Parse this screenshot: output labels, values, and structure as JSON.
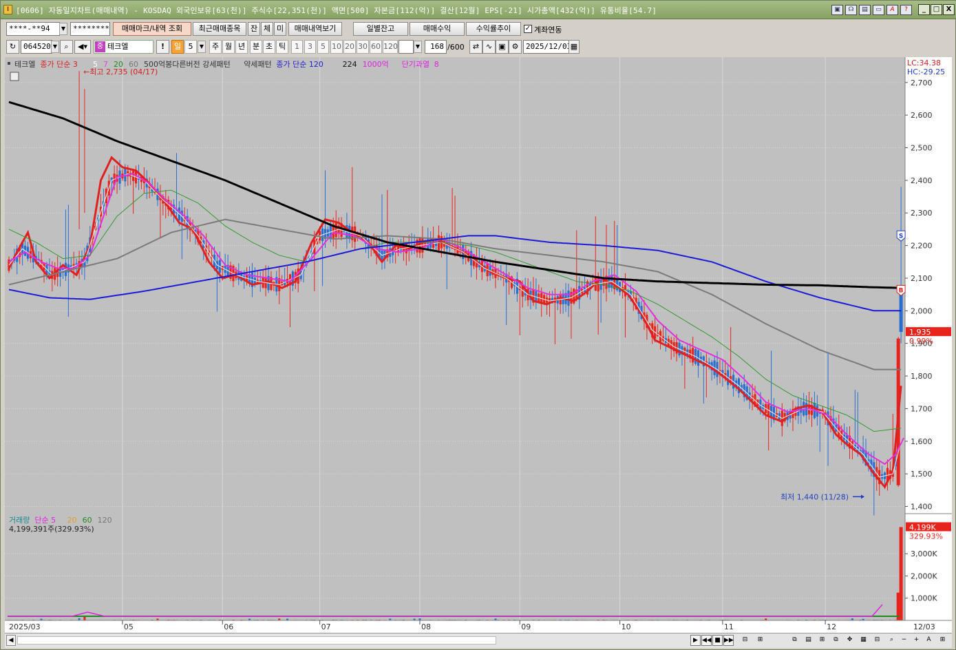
{
  "titlebar": {
    "app_icon": "I",
    "title": "[0606] 자동일지차트(매매내역) - KOSDAQ 외국인보유[63(천)] 주식수[22,351(천)] 액면[500] 자본금[112(억)] 결산[12월] EPS[-21] 시가총액[432(억)] 유통비율[54.7]",
    "icons": [
      "window-icon",
      "link-icon",
      "chart-icon",
      "monitor-icon",
      "a-icon",
      "help-icon"
    ],
    "icon_glyphs": [
      "▣",
      "☊",
      "▤",
      "▭",
      "A",
      "?"
    ],
    "controls": {
      "minimize": "_",
      "maximize": "□",
      "close": "X"
    }
  },
  "toolbar1": {
    "account_value": "****-**94",
    "password_value": "*********",
    "buttons": [
      "매매마크/내역 조회",
      "최근매매종목",
      "잔",
      "체",
      "미",
      "매매내역보기"
    ],
    "right_buttons": [
      "일별잔고",
      "매매수익",
      "수익률추이"
    ],
    "link_checkbox_label": "계좌연동",
    "link_checked": true
  },
  "toolbar2": {
    "stock_code": "064520",
    "stock_name": "테크엘",
    "stock_badge": "중",
    "period_buttons": [
      "일",
      "5",
      "주",
      "월",
      "년",
      "분",
      "초",
      "틱"
    ],
    "interval_buttons": [
      "1",
      "3",
      "5",
      "10",
      "20",
      "30",
      "60",
      "120"
    ],
    "count_value": "168",
    "count_total": "/600",
    "date_value": "2025/12/03",
    "bang": "!"
  },
  "price_legend": [
    {
      "text": "테크엘",
      "color": "#333333"
    },
    {
      "text": "종가 단순 3",
      "color": "#d62020"
    },
    {
      "text": "5",
      "color": "#ffffff"
    },
    {
      "text": "7",
      "color": "#e040e0"
    },
    {
      "text": "20",
      "color": "#208a20"
    },
    {
      "text": "60",
      "color": "#777777"
    },
    {
      "text": "500억봉다른버전 강세패턴",
      "color": "#333333"
    },
    {
      "text": "약세패턴",
      "color": "#333333"
    },
    {
      "text": "종가 단순 120",
      "color": "#2020d0"
    },
    {
      "text": "224",
      "color": "#111111"
    },
    {
      "text": "1000억",
      "color": "#e020e0"
    },
    {
      "text": "단기과열",
      "color": "#e020e0"
    },
    {
      "text": "8",
      "color": "#e020e0"
    }
  ],
  "volume_legend": [
    {
      "text": "거래량",
      "color": "#1a8a8a"
    },
    {
      "text": "단순 5",
      "color": "#e020e0"
    },
    {
      "text": "20",
      "color": "#e0a020"
    },
    {
      "text": "60",
      "color": "#208a20"
    },
    {
      "text": "120",
      "color": "#777777"
    }
  ],
  "volume_value_text": "4,199,391주(329.93%)",
  "lc_text": "LC:34.38",
  "hc_text": "HC:-29.25",
  "max_annotation": "←최고 2,735 (04/17)",
  "min_annotation": "최저 1,440 (11/28)",
  "current_price_tag": "1,935",
  "current_pct_tag": "0.99%",
  "volume_tag": "4,199K",
  "volume_pct_tag": "329.93%",
  "signal_sell": "S",
  "signal_buy": "B",
  "price_axis_ticks": [
    "2,700",
    "2,600",
    "2,500",
    "2,400",
    "2,300",
    "2,200",
    "2,100",
    "2,000",
    "1,900",
    "1,800",
    "1,700",
    "1,600",
    "1,500",
    "1,400"
  ],
  "volume_axis_ticks": [
    "3,000K",
    "2,000K",
    "1,000K"
  ],
  "date_axis_labels": [
    "2025/03",
    "05",
    "06",
    "07",
    "08",
    "09",
    "10",
    "11",
    "12",
    "12/03"
  ],
  "colors": {
    "chart_bg": "#c0c0c0",
    "up_candle": "#e8231c",
    "down_candle": "#2a6fd0",
    "ma3": "#e02020",
    "ma5": "#f4f4f4",
    "ma7": "#e030e0",
    "ma20": "#2f9a2f",
    "ma60": "#7a7a7a",
    "ma120": "#1a1ad8",
    "ma224": "#000000"
  },
  "chart_data": {
    "type": "candlestick",
    "y_range": [
      1380,
      2765
    ],
    "volume_range": [
      0,
      4400
    ],
    "volume_unit": "K",
    "max_point": {
      "price": 2735,
      "date": "04/17"
    },
    "min_point": {
      "price": 1440,
      "date": "11/28"
    },
    "last_close": 1935,
    "last_volume_k": 4199,
    "series": [
      {
        "name": "종가 단순 3",
        "points": [
          [
            0,
            2130
          ],
          [
            3,
            2180
          ],
          [
            7,
            2240
          ],
          [
            10,
            2150
          ],
          [
            15,
            2100
          ],
          [
            20,
            2140
          ],
          [
            25,
            2110
          ],
          [
            30,
            2200
          ],
          [
            34,
            2400
          ],
          [
            38,
            2470
          ],
          [
            42,
            2440
          ],
          [
            47,
            2430
          ],
          [
            52,
            2390
          ],
          [
            58,
            2330
          ],
          [
            63,
            2270
          ],
          [
            68,
            2250
          ],
          [
            74,
            2150
          ],
          [
            79,
            2100
          ],
          [
            84,
            2110
          ],
          [
            90,
            2080
          ],
          [
            96,
            2090
          ],
          [
            101,
            2070
          ],
          [
            106,
            2090
          ],
          [
            112,
            2210
          ],
          [
            117,
            2280
          ],
          [
            122,
            2270
          ],
          [
            127,
            2240
          ],
          [
            133,
            2210
          ],
          [
            138,
            2150
          ],
          [
            143,
            2200
          ],
          [
            148,
            2190
          ],
          [
            153,
            2210
          ],
          [
            158,
            2220
          ],
          [
            163,
            2200
          ],
          [
            168,
            2180
          ],
          [
            173,
            2150
          ],
          [
            178,
            2120
          ],
          [
            184,
            2100
          ],
          [
            189,
            2090
          ],
          [
            194,
            2030
          ],
          [
            199,
            2020
          ],
          [
            204,
            2040
          ],
          [
            209,
            2030
          ],
          [
            214,
            2060
          ],
          [
            219,
            2100
          ],
          [
            224,
            2080
          ],
          [
            229,
            2050
          ],
          [
            234,
            1990
          ],
          [
            239,
            1910
          ],
          [
            244,
            1890
          ],
          [
            249,
            1870
          ],
          [
            254,
            1850
          ],
          [
            259,
            1830
          ],
          [
            264,
            1800
          ],
          [
            270,
            1760
          ],
          [
            275,
            1720
          ],
          [
            280,
            1680
          ],
          [
            286,
            1660
          ],
          [
            291,
            1700
          ],
          [
            296,
            1710
          ],
          [
            301,
            1690
          ],
          [
            306,
            1620
          ],
          [
            310,
            1590
          ],
          [
            315,
            1560
          ],
          [
            320,
            1500
          ],
          [
            324,
            1460
          ],
          [
            327,
            1510
          ],
          [
            330,
            1770
          ]
        ]
      },
      {
        "name": "5",
        "points": [
          [
            0,
            2140
          ],
          [
            5,
            2190
          ],
          [
            10,
            2160
          ],
          [
            16,
            2110
          ],
          [
            22,
            2130
          ],
          [
            28,
            2150
          ],
          [
            33,
            2280
          ],
          [
            38,
            2400
          ],
          [
            44,
            2420
          ],
          [
            50,
            2400
          ],
          [
            57,
            2340
          ],
          [
            64,
            2290
          ],
          [
            70,
            2230
          ],
          [
            77,
            2140
          ],
          [
            84,
            2110
          ],
          [
            92,
            2090
          ],
          [
            100,
            2080
          ],
          [
            108,
            2110
          ],
          [
            115,
            2230
          ],
          [
            122,
            2250
          ],
          [
            130,
            2230
          ],
          [
            138,
            2170
          ],
          [
            145,
            2190
          ],
          [
            152,
            2200
          ],
          [
            160,
            2210
          ],
          [
            168,
            2180
          ],
          [
            176,
            2130
          ],
          [
            184,
            2100
          ],
          [
            192,
            2050
          ],
          [
            200,
            2030
          ],
          [
            208,
            2040
          ],
          [
            216,
            2080
          ],
          [
            223,
            2090
          ],
          [
            230,
            2050
          ],
          [
            238,
            1940
          ],
          [
            246,
            1890
          ],
          [
            254,
            1860
          ],
          [
            262,
            1820
          ],
          [
            270,
            1770
          ],
          [
            278,
            1710
          ],
          [
            286,
            1670
          ],
          [
            294,
            1700
          ],
          [
            301,
            1690
          ],
          [
            308,
            1620
          ],
          [
            316,
            1560
          ],
          [
            322,
            1490
          ],
          [
            327,
            1500
          ],
          [
            330,
            1600
          ]
        ]
      },
      {
        "name": "7",
        "points": [
          [
            0,
            2150
          ],
          [
            6,
            2180
          ],
          [
            12,
            2150
          ],
          [
            18,
            2130
          ],
          [
            24,
            2130
          ],
          [
            30,
            2170
          ],
          [
            35,
            2290
          ],
          [
            40,
            2410
          ],
          [
            46,
            2420
          ],
          [
            52,
            2390
          ],
          [
            58,
            2340
          ],
          [
            65,
            2290
          ],
          [
            72,
            2230
          ],
          [
            80,
            2140
          ],
          [
            88,
            2110
          ],
          [
            96,
            2100
          ],
          [
            104,
            2090
          ],
          [
            112,
            2160
          ],
          [
            120,
            2240
          ],
          [
            128,
            2230
          ],
          [
            136,
            2190
          ],
          [
            144,
            2180
          ],
          [
            152,
            2190
          ],
          [
            160,
            2220
          ],
          [
            168,
            2190
          ],
          [
            176,
            2150
          ],
          [
            184,
            2110
          ],
          [
            192,
            2070
          ],
          [
            200,
            2050
          ],
          [
            208,
            2050
          ],
          [
            216,
            2090
          ],
          [
            224,
            2110
          ],
          [
            232,
            2060
          ],
          [
            240,
            1970
          ],
          [
            248,
            1910
          ],
          [
            256,
            1880
          ],
          [
            264,
            1850
          ],
          [
            272,
            1790
          ],
          [
            280,
            1720
          ],
          [
            288,
            1690
          ],
          [
            296,
            1700
          ],
          [
            303,
            1680
          ],
          [
            310,
            1620
          ],
          [
            318,
            1560
          ],
          [
            324,
            1530
          ],
          [
            328,
            1560
          ],
          [
            331,
            1610
          ]
        ]
      },
      {
        "name": "20",
        "points": [
          [
            0,
            2250
          ],
          [
            10,
            2210
          ],
          [
            20,
            2160
          ],
          [
            30,
            2170
          ],
          [
            40,
            2290
          ],
          [
            50,
            2360
          ],
          [
            60,
            2370
          ],
          [
            70,
            2330
          ],
          [
            80,
            2260
          ],
          [
            90,
            2210
          ],
          [
            100,
            2170
          ],
          [
            110,
            2150
          ],
          [
            120,
            2170
          ],
          [
            130,
            2190
          ],
          [
            140,
            2210
          ],
          [
            150,
            2210
          ],
          [
            160,
            2210
          ],
          [
            170,
            2200
          ],
          [
            180,
            2180
          ],
          [
            190,
            2150
          ],
          [
            200,
            2120
          ],
          [
            210,
            2090
          ],
          [
            220,
            2080
          ],
          [
            230,
            2060
          ],
          [
            240,
            2020
          ],
          [
            250,
            1970
          ],
          [
            260,
            1920
          ],
          [
            270,
            1860
          ],
          [
            280,
            1790
          ],
          [
            290,
            1740
          ],
          [
            300,
            1710
          ],
          [
            310,
            1680
          ],
          [
            320,
            1630
          ],
          [
            330,
            1640
          ]
        ]
      },
      {
        "name": "60",
        "points": [
          [
            0,
            2080
          ],
          [
            20,
            2120
          ],
          [
            40,
            2160
          ],
          [
            60,
            2240
          ],
          [
            80,
            2280
          ],
          [
            100,
            2250
          ],
          [
            120,
            2220
          ],
          [
            140,
            2230
          ],
          [
            160,
            2220
          ],
          [
            180,
            2190
          ],
          [
            200,
            2170
          ],
          [
            220,
            2150
          ],
          [
            240,
            2120
          ],
          [
            260,
            2050
          ],
          [
            280,
            1960
          ],
          [
            300,
            1880
          ],
          [
            320,
            1820
          ],
          [
            330,
            1820
          ]
        ]
      },
      {
        "name": "종가 단순 120",
        "points": [
          [
            0,
            2065
          ],
          [
            15,
            2040
          ],
          [
            30,
            2035
          ],
          [
            50,
            2060
          ],
          [
            70,
            2090
          ],
          [
            90,
            2120
          ],
          [
            110,
            2150
          ],
          [
            130,
            2190
          ],
          [
            150,
            2210
          ],
          [
            170,
            2230
          ],
          [
            180,
            2230
          ],
          [
            200,
            2210
          ],
          [
            220,
            2200
          ],
          [
            240,
            2185
          ],
          [
            260,
            2150
          ],
          [
            280,
            2090
          ],
          [
            300,
            2040
          ],
          [
            320,
            2000
          ],
          [
            330,
            2000
          ]
        ]
      },
      {
        "name": "224",
        "points": [
          [
            0,
            2640
          ],
          [
            20,
            2590
          ],
          [
            40,
            2520
          ],
          [
            60,
            2460
          ],
          [
            80,
            2400
          ],
          [
            100,
            2330
          ],
          [
            120,
            2260
          ],
          [
            140,
            2210
          ],
          [
            160,
            2180
          ],
          [
            180,
            2150
          ],
          [
            200,
            2125
          ],
          [
            220,
            2100
          ],
          [
            240,
            2090
          ],
          [
            260,
            2085
          ],
          [
            280,
            2080
          ],
          [
            300,
            2078
          ],
          [
            320,
            2072
          ],
          [
            330,
            2070
          ]
        ]
      }
    ]
  }
}
